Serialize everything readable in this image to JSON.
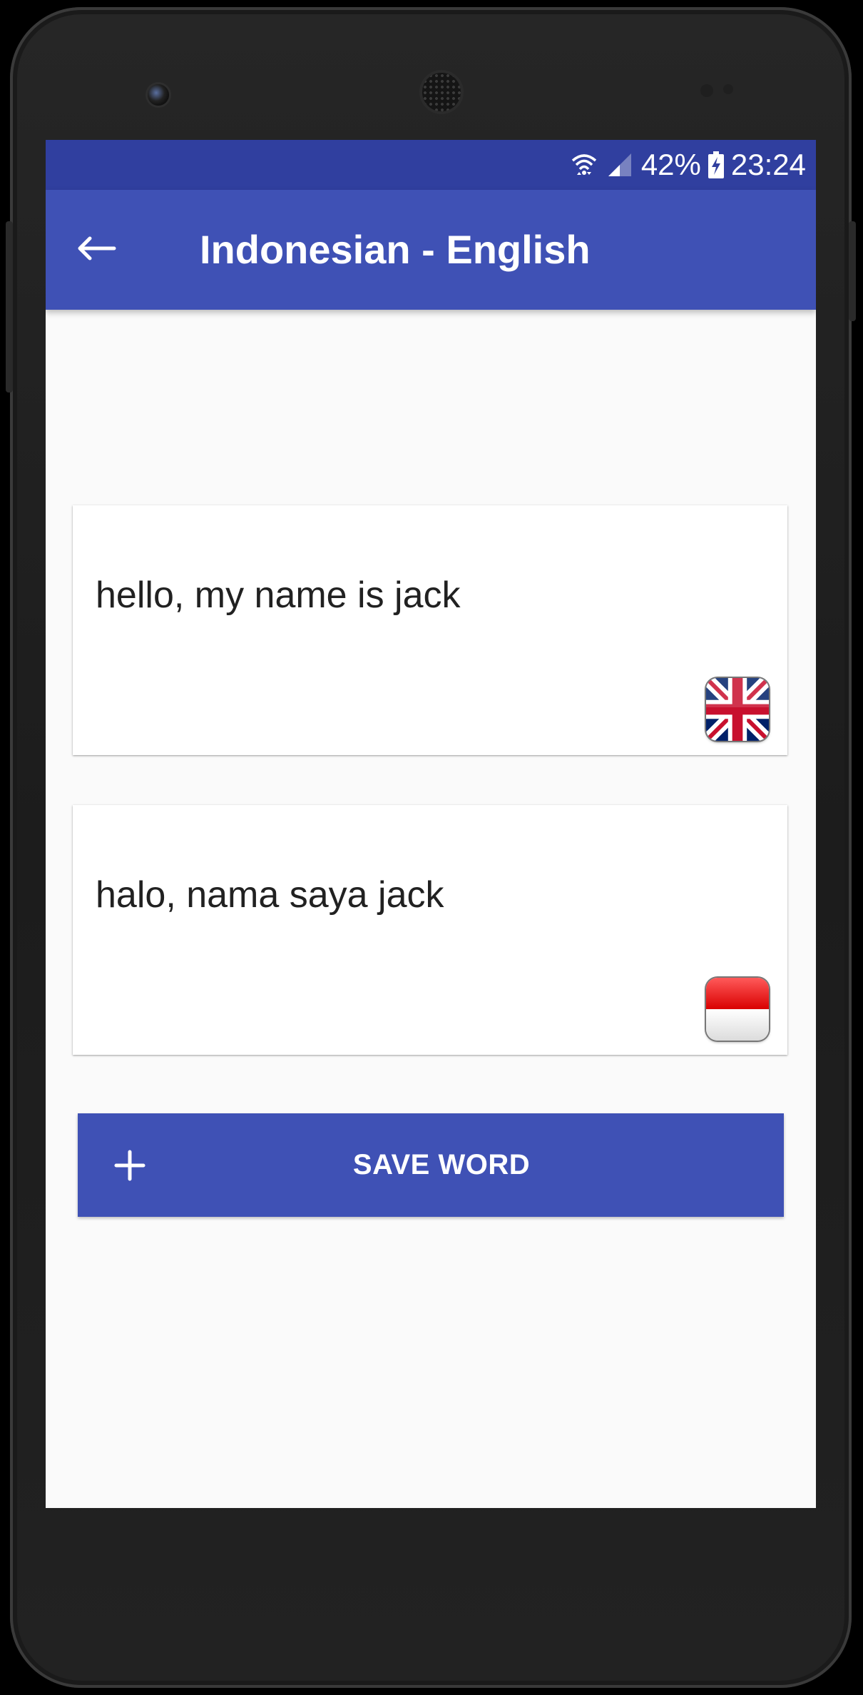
{
  "status_bar": {
    "battery": "42%",
    "time": "23:24",
    "icons": [
      "wifi-icon",
      "signal-icon",
      "battery-charging-icon"
    ]
  },
  "app_bar": {
    "title": "Indonesian - English",
    "back_icon": "arrow-left-icon"
  },
  "cards": [
    {
      "text": "hello, my name is jack",
      "flag_icon": "uk-flag-icon"
    },
    {
      "text": "halo, nama saya jack",
      "flag_icon": "indonesia-flag-icon"
    }
  ],
  "save_button": {
    "label": "SAVE WORD",
    "icon": "plus-icon"
  },
  "colors": {
    "primary": "#3f51b5",
    "primary_dark": "#303f9f",
    "background": "#fafafa",
    "text": "#212121"
  }
}
